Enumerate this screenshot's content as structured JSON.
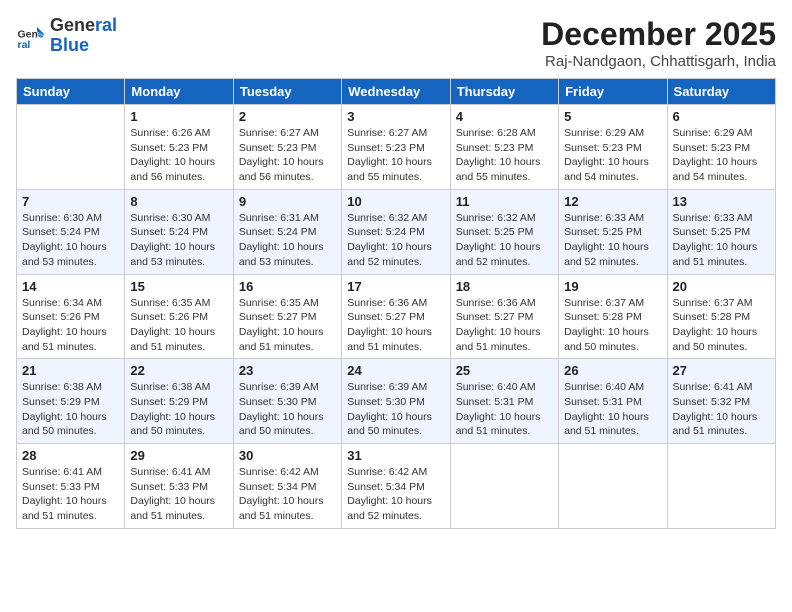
{
  "logo": {
    "line1": "General",
    "line2": "Blue"
  },
  "title": "December 2025",
  "location": "Raj-Nandgaon, Chhattisgarh, India",
  "days_header": [
    "Sunday",
    "Monday",
    "Tuesday",
    "Wednesday",
    "Thursday",
    "Friday",
    "Saturday"
  ],
  "weeks": [
    [
      {
        "num": "",
        "info": ""
      },
      {
        "num": "1",
        "info": "Sunrise: 6:26 AM\nSunset: 5:23 PM\nDaylight: 10 hours\nand 56 minutes."
      },
      {
        "num": "2",
        "info": "Sunrise: 6:27 AM\nSunset: 5:23 PM\nDaylight: 10 hours\nand 56 minutes."
      },
      {
        "num": "3",
        "info": "Sunrise: 6:27 AM\nSunset: 5:23 PM\nDaylight: 10 hours\nand 55 minutes."
      },
      {
        "num": "4",
        "info": "Sunrise: 6:28 AM\nSunset: 5:23 PM\nDaylight: 10 hours\nand 55 minutes."
      },
      {
        "num": "5",
        "info": "Sunrise: 6:29 AM\nSunset: 5:23 PM\nDaylight: 10 hours\nand 54 minutes."
      },
      {
        "num": "6",
        "info": "Sunrise: 6:29 AM\nSunset: 5:23 PM\nDaylight: 10 hours\nand 54 minutes."
      }
    ],
    [
      {
        "num": "7",
        "info": "Sunrise: 6:30 AM\nSunset: 5:24 PM\nDaylight: 10 hours\nand 53 minutes."
      },
      {
        "num": "8",
        "info": "Sunrise: 6:30 AM\nSunset: 5:24 PM\nDaylight: 10 hours\nand 53 minutes."
      },
      {
        "num": "9",
        "info": "Sunrise: 6:31 AM\nSunset: 5:24 PM\nDaylight: 10 hours\nand 53 minutes."
      },
      {
        "num": "10",
        "info": "Sunrise: 6:32 AM\nSunset: 5:24 PM\nDaylight: 10 hours\nand 52 minutes."
      },
      {
        "num": "11",
        "info": "Sunrise: 6:32 AM\nSunset: 5:25 PM\nDaylight: 10 hours\nand 52 minutes."
      },
      {
        "num": "12",
        "info": "Sunrise: 6:33 AM\nSunset: 5:25 PM\nDaylight: 10 hours\nand 52 minutes."
      },
      {
        "num": "13",
        "info": "Sunrise: 6:33 AM\nSunset: 5:25 PM\nDaylight: 10 hours\nand 51 minutes."
      }
    ],
    [
      {
        "num": "14",
        "info": "Sunrise: 6:34 AM\nSunset: 5:26 PM\nDaylight: 10 hours\nand 51 minutes."
      },
      {
        "num": "15",
        "info": "Sunrise: 6:35 AM\nSunset: 5:26 PM\nDaylight: 10 hours\nand 51 minutes."
      },
      {
        "num": "16",
        "info": "Sunrise: 6:35 AM\nSunset: 5:27 PM\nDaylight: 10 hours\nand 51 minutes."
      },
      {
        "num": "17",
        "info": "Sunrise: 6:36 AM\nSunset: 5:27 PM\nDaylight: 10 hours\nand 51 minutes."
      },
      {
        "num": "18",
        "info": "Sunrise: 6:36 AM\nSunset: 5:27 PM\nDaylight: 10 hours\nand 51 minutes."
      },
      {
        "num": "19",
        "info": "Sunrise: 6:37 AM\nSunset: 5:28 PM\nDaylight: 10 hours\nand 50 minutes."
      },
      {
        "num": "20",
        "info": "Sunrise: 6:37 AM\nSunset: 5:28 PM\nDaylight: 10 hours\nand 50 minutes."
      }
    ],
    [
      {
        "num": "21",
        "info": "Sunrise: 6:38 AM\nSunset: 5:29 PM\nDaylight: 10 hours\nand 50 minutes."
      },
      {
        "num": "22",
        "info": "Sunrise: 6:38 AM\nSunset: 5:29 PM\nDaylight: 10 hours\nand 50 minutes."
      },
      {
        "num": "23",
        "info": "Sunrise: 6:39 AM\nSunset: 5:30 PM\nDaylight: 10 hours\nand 50 minutes."
      },
      {
        "num": "24",
        "info": "Sunrise: 6:39 AM\nSunset: 5:30 PM\nDaylight: 10 hours\nand 50 minutes."
      },
      {
        "num": "25",
        "info": "Sunrise: 6:40 AM\nSunset: 5:31 PM\nDaylight: 10 hours\nand 51 minutes."
      },
      {
        "num": "26",
        "info": "Sunrise: 6:40 AM\nSunset: 5:31 PM\nDaylight: 10 hours\nand 51 minutes."
      },
      {
        "num": "27",
        "info": "Sunrise: 6:41 AM\nSunset: 5:32 PM\nDaylight: 10 hours\nand 51 minutes."
      }
    ],
    [
      {
        "num": "28",
        "info": "Sunrise: 6:41 AM\nSunset: 5:33 PM\nDaylight: 10 hours\nand 51 minutes."
      },
      {
        "num": "29",
        "info": "Sunrise: 6:41 AM\nSunset: 5:33 PM\nDaylight: 10 hours\nand 51 minutes."
      },
      {
        "num": "30",
        "info": "Sunrise: 6:42 AM\nSunset: 5:34 PM\nDaylight: 10 hours\nand 51 minutes."
      },
      {
        "num": "31",
        "info": "Sunrise: 6:42 AM\nSunset: 5:34 PM\nDaylight: 10 hours\nand 52 minutes."
      },
      {
        "num": "",
        "info": ""
      },
      {
        "num": "",
        "info": ""
      },
      {
        "num": "",
        "info": ""
      }
    ]
  ]
}
